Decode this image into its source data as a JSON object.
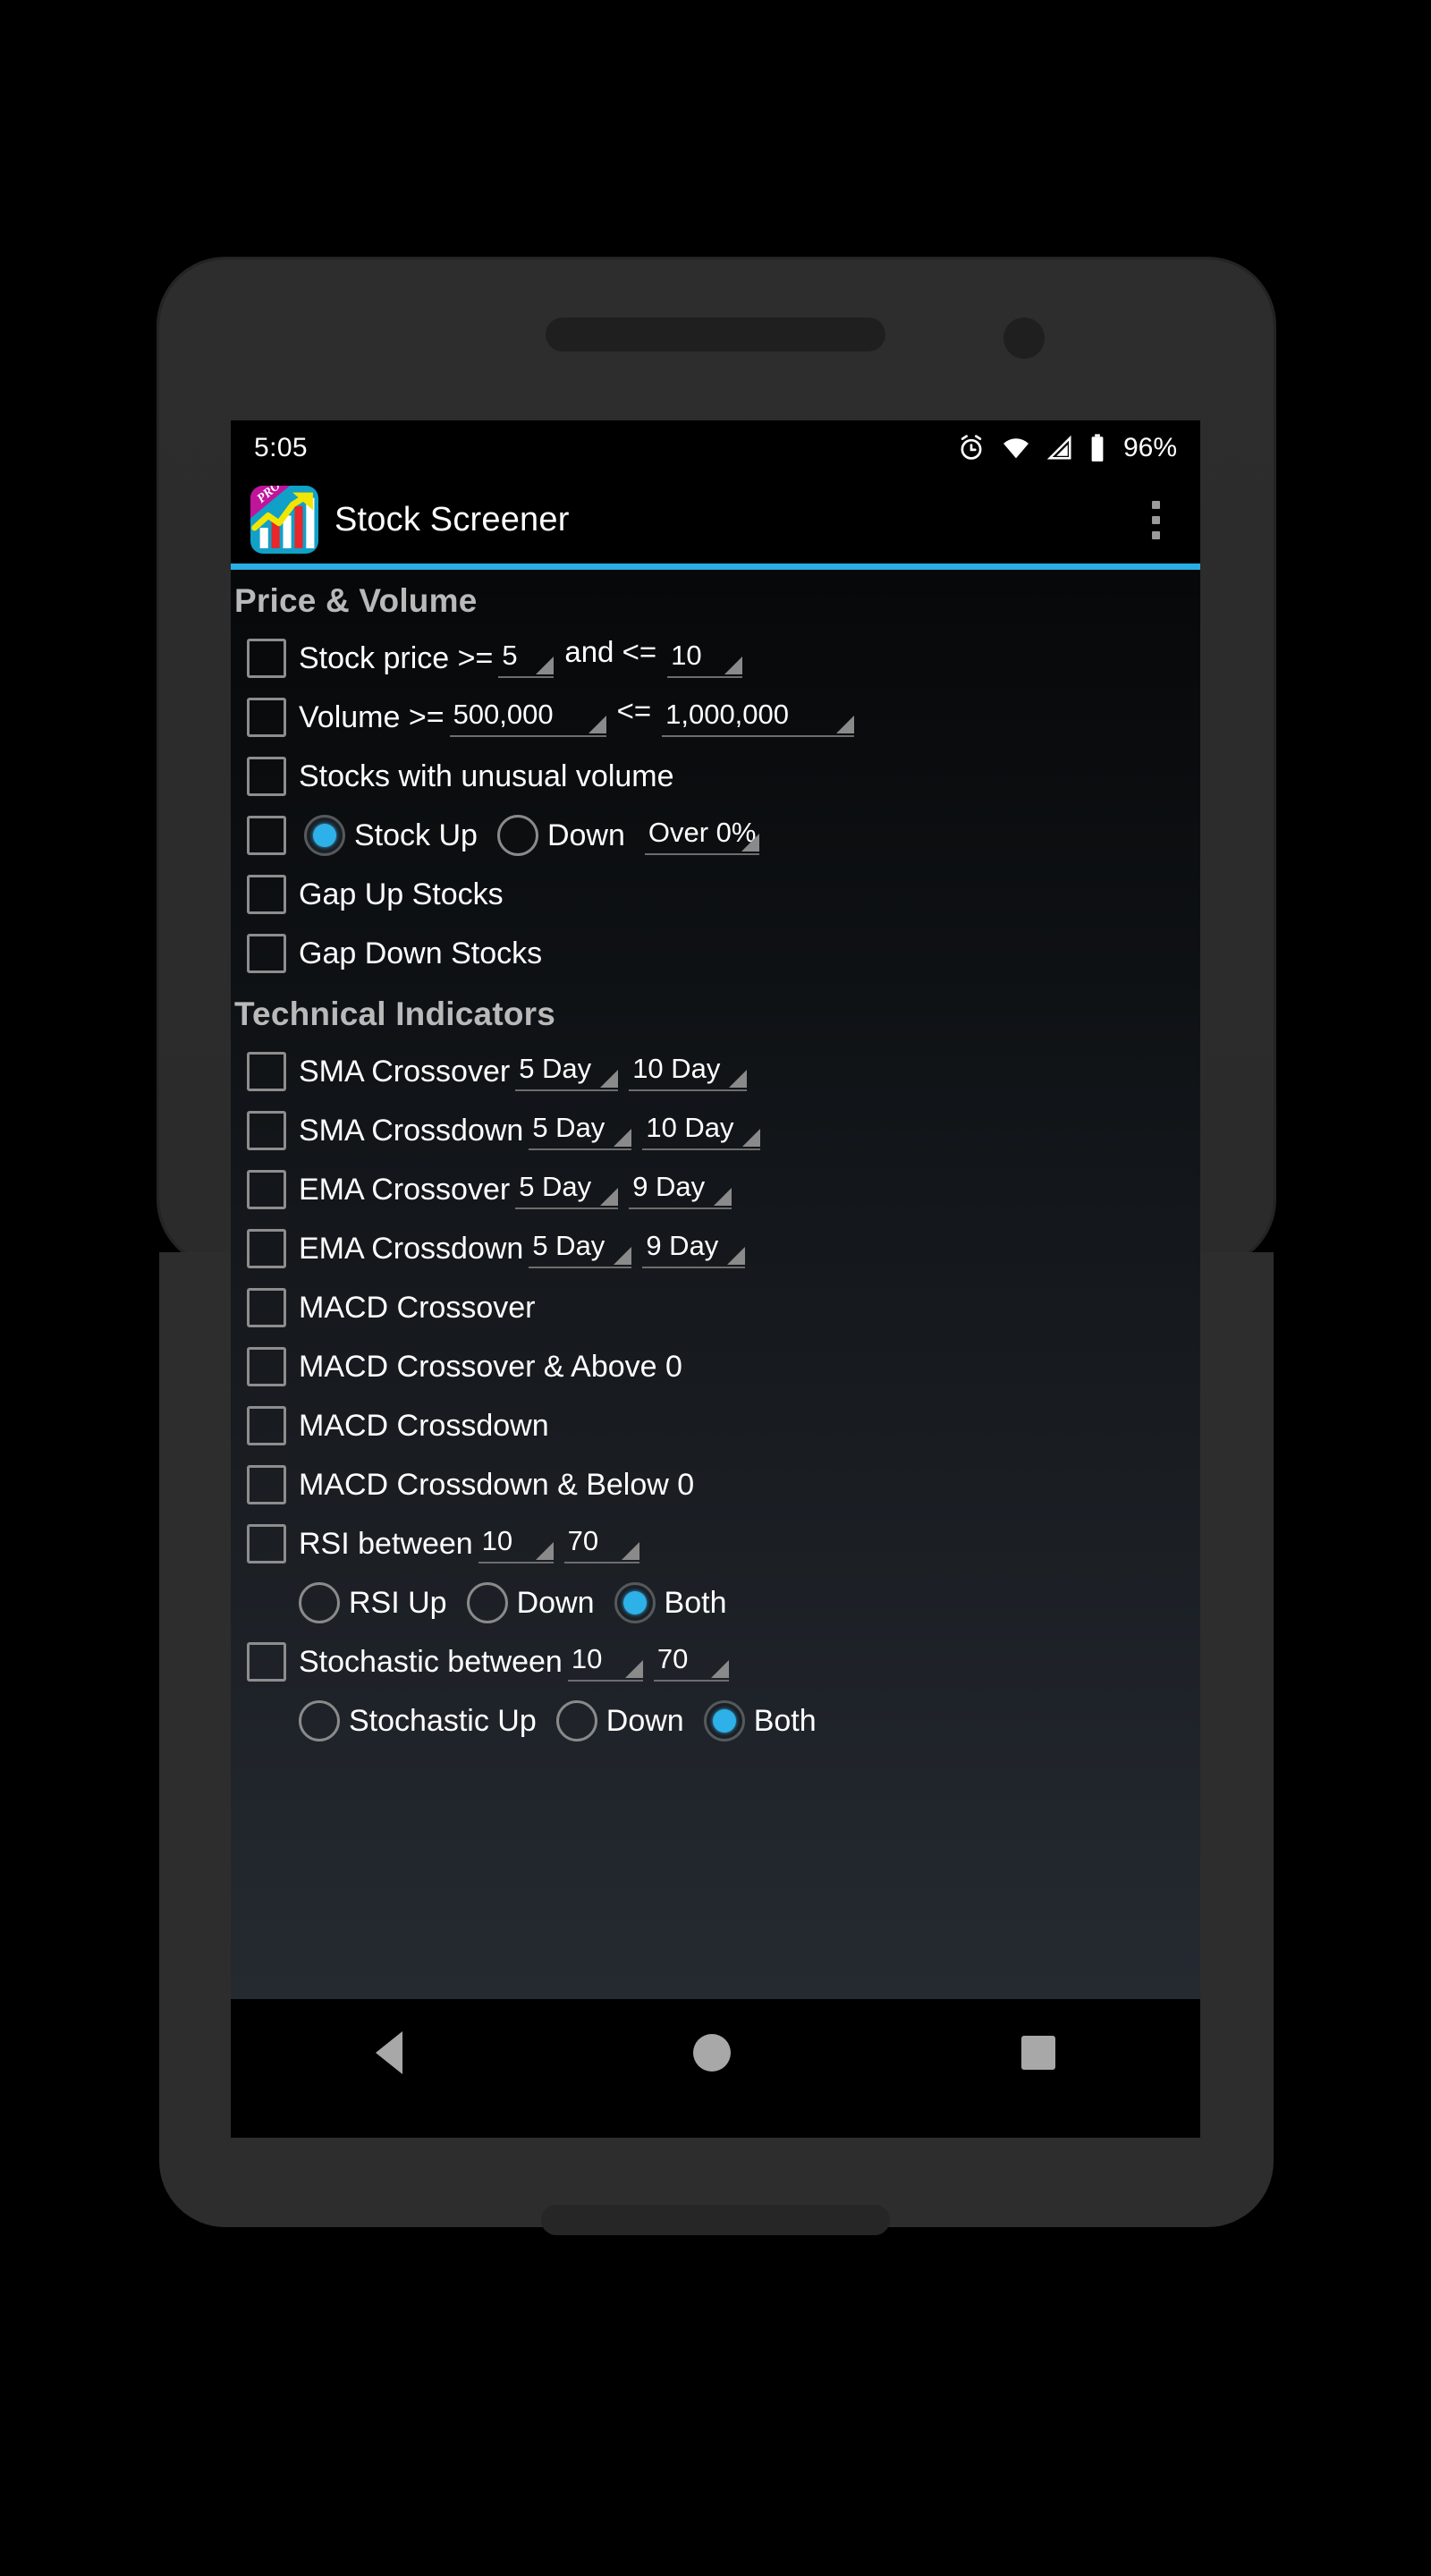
{
  "status_bar": {
    "time": "5:05",
    "battery_percent": "96%",
    "icons": [
      "alarm-icon",
      "wifi-icon",
      "cell-signal-icon",
      "battery-icon"
    ]
  },
  "app_bar": {
    "title": "Stock Screener",
    "logo_badge": "PRO",
    "overflow_label": "More options"
  },
  "colors": {
    "accent": "#2aade3",
    "radio_on": "#2eb0e8",
    "section_header": "#b9b9b9",
    "label": "#ffffff"
  },
  "sections": [
    {
      "id": "price-volume",
      "title": "Price & Volume",
      "rows": [
        {
          "id": "stock-price",
          "checkbox": false,
          "label": "Stock price >=",
          "spinner1": "5",
          "mid_label": "and <=",
          "spinner2": "10"
        },
        {
          "id": "volume",
          "checkbox": false,
          "label": "Volume >=",
          "spinner1": "500,000",
          "mid_label": "<=",
          "spinner2": "1,000,000"
        },
        {
          "id": "unusual-volume",
          "checkbox": false,
          "label": "Stocks with unusual volume"
        },
        {
          "id": "stock-direction",
          "checkbox": false,
          "radios": [
            {
              "label": "Stock Up",
              "selected": true
            },
            {
              "label": "Down",
              "selected": false
            }
          ],
          "spinner1": "Over 0%"
        },
        {
          "id": "gap-up",
          "checkbox": false,
          "label": "Gap Up Stocks"
        },
        {
          "id": "gap-down",
          "checkbox": false,
          "label": "Gap Down Stocks"
        }
      ]
    },
    {
      "id": "technical-indicators",
      "title": "Technical Indicators",
      "rows": [
        {
          "id": "sma-crossover",
          "checkbox": false,
          "label": "SMA Crossover",
          "spinner1": "5 Day",
          "spinner2": "10 Day"
        },
        {
          "id": "sma-crossdown",
          "checkbox": false,
          "label": "SMA Crossdown",
          "spinner1": "5 Day",
          "spinner2": "10 Day"
        },
        {
          "id": "ema-crossover",
          "checkbox": false,
          "label": "EMA Crossover",
          "spinner1": "5 Day",
          "spinner2": "9 Day"
        },
        {
          "id": "ema-crossdown",
          "checkbox": false,
          "label": "EMA Crossdown",
          "spinner1": "5 Day",
          "spinner2": "9 Day"
        },
        {
          "id": "macd-crossover",
          "checkbox": false,
          "label": "MACD Crossover"
        },
        {
          "id": "macd-crossover-above-0",
          "checkbox": false,
          "label": "MACD Crossover & Above 0"
        },
        {
          "id": "macd-crossdown",
          "checkbox": false,
          "label": "MACD Crossdown"
        },
        {
          "id": "macd-crossdown-below-0",
          "checkbox": false,
          "label": "MACD Crossdown & Below 0"
        },
        {
          "id": "rsi-between",
          "checkbox": false,
          "label": "RSI between",
          "spinner1": "10",
          "spinner2": "70"
        },
        {
          "id": "rsi-direction",
          "radios": [
            {
              "label": "RSI Up",
              "selected": false
            },
            {
              "label": "Down",
              "selected": false
            },
            {
              "label": "Both",
              "selected": true
            }
          ]
        },
        {
          "id": "stochastic-between",
          "checkbox": false,
          "label": "Stochastic between",
          "spinner1": "10",
          "spinner2": "70"
        },
        {
          "id": "stochastic-direction",
          "radios": [
            {
              "label": "Stochastic Up",
              "selected": false
            },
            {
              "label": "Down",
              "selected": false
            },
            {
              "label": "Both",
              "selected": true
            }
          ]
        }
      ]
    }
  ],
  "nav_bar": {
    "back": "back-button",
    "home": "home-button",
    "recents": "recents-button"
  }
}
